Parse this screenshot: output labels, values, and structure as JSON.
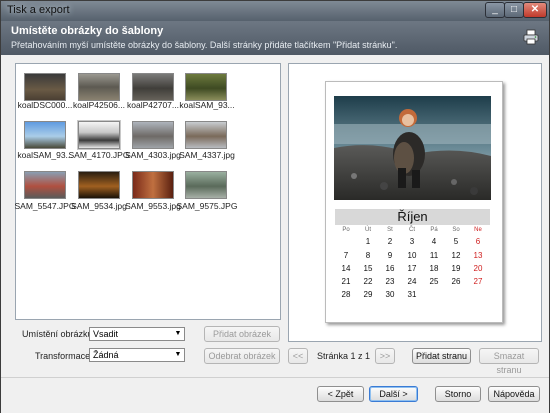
{
  "window": {
    "title": "Tisk a export"
  },
  "header": {
    "title": "Umístěte obrázky do šablony",
    "subtitle": "Přetahováním myší umístěte obrázky do šablony. Další stránky přidáte tlačítkem \"Přidat stránku\"."
  },
  "images": [
    {
      "name": "koalDSC000..."
    },
    {
      "name": "koalP42506..."
    },
    {
      "name": "koalP42707..."
    },
    {
      "name": "koalSAM_93..."
    },
    {
      "name": "koalSAM_93..."
    },
    {
      "name": "SAM_4170.JPG"
    },
    {
      "name": "SAM_4303.jpg"
    },
    {
      "name": "SAM_4337.jpg"
    },
    {
      "name": "SAM_5547.JPG"
    },
    {
      "name": "SAM_9534.jpg"
    },
    {
      "name": "SAM_9553.jpg"
    },
    {
      "name": "SAM_9575.JPG"
    }
  ],
  "calendar": {
    "month": "Říjen",
    "weekdays": [
      "Po",
      "Út",
      "St",
      "Čt",
      "Pá",
      "So",
      "Ne"
    ],
    "weeks": [
      [
        "",
        "1",
        "2",
        "3",
        "4",
        "5",
        "6"
      ],
      [
        "7",
        "8",
        "9",
        "10",
        "11",
        "12",
        "13"
      ],
      [
        "14",
        "15",
        "16",
        "17",
        "18",
        "19",
        "20"
      ],
      [
        "21",
        "22",
        "23",
        "24",
        "25",
        "26",
        "27"
      ],
      [
        "28",
        "29",
        "30",
        "31",
        "",
        "",
        ""
      ]
    ]
  },
  "controls": {
    "placement_label": "Umístění obrázku:",
    "placement_value": "Vsadit",
    "transform_label": "Transformace:",
    "transform_value": "Žádná",
    "add_image": "Přidat obrázek",
    "remove_image": "Odebrat obrázek",
    "prev_page": "<<",
    "page_info": "Stránka 1 z 1",
    "next_page": ">>",
    "add_page": "Přidat stranu",
    "delete_page": "Smazat stranu"
  },
  "footer": {
    "back": "< Zpět",
    "next": "Další >",
    "cancel": "Storno",
    "help": "Nápověda"
  }
}
